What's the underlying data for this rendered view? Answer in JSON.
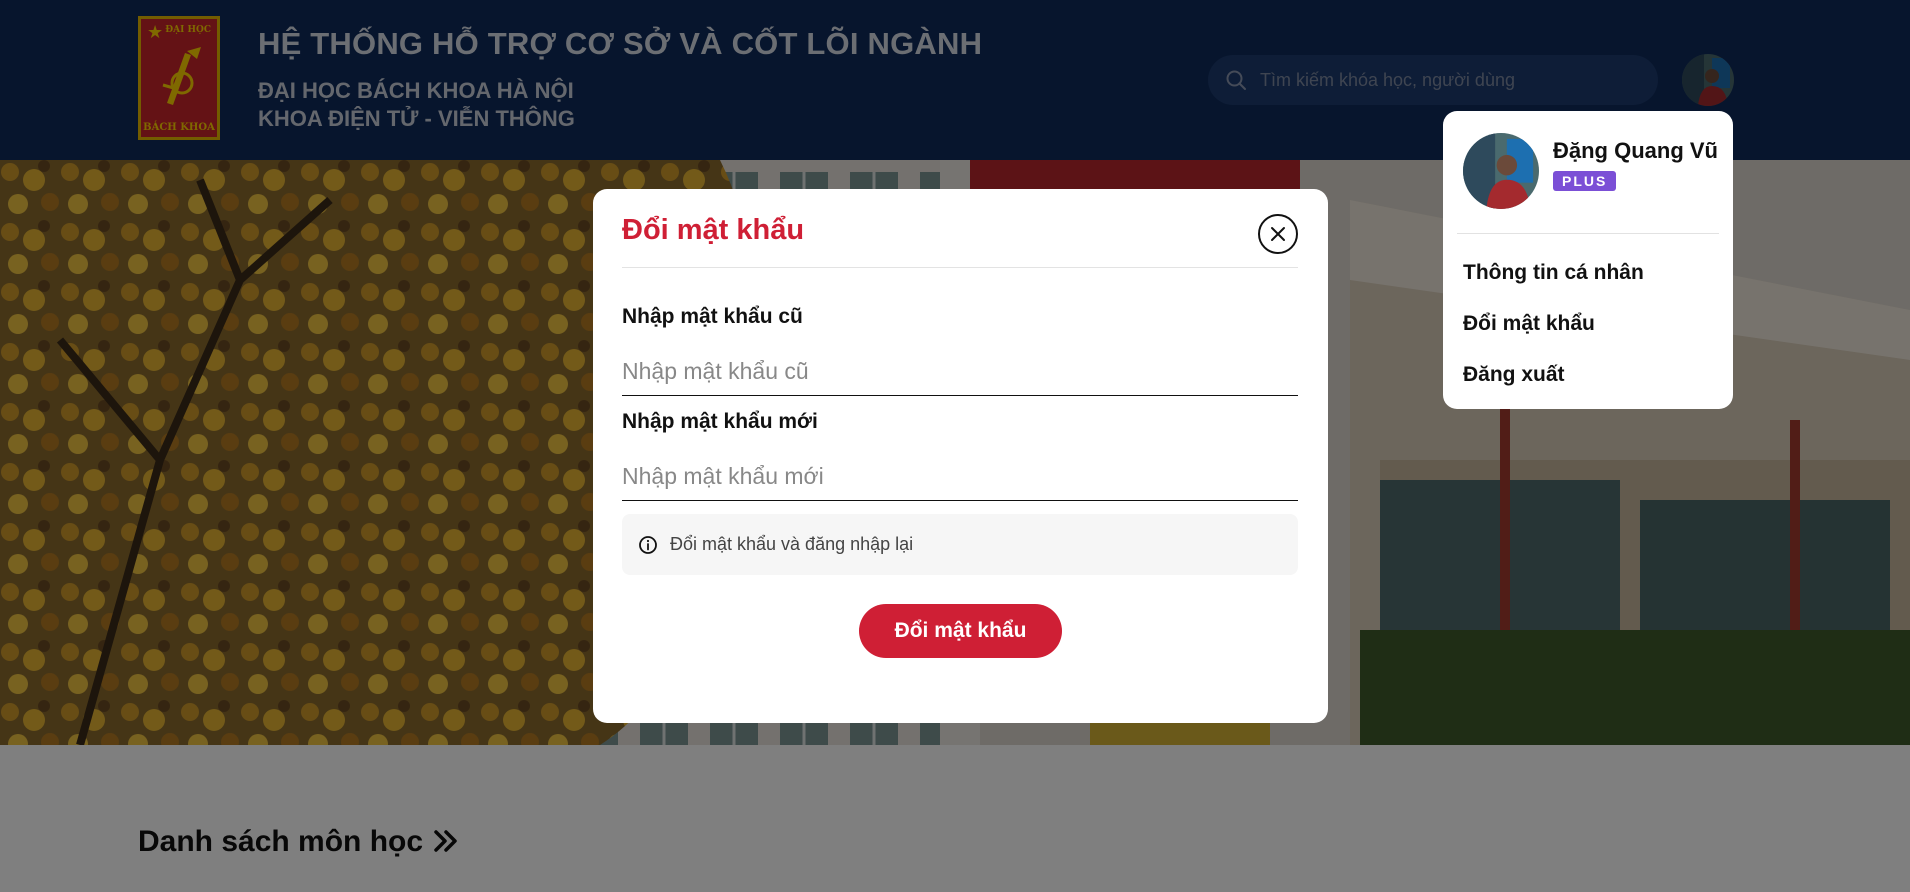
{
  "header": {
    "logo_text_top": "ĐẠI HỌC",
    "logo_text_bottom": "BÁCH KHOA",
    "title": "HỆ THỐNG HỖ TRỢ CƠ SỞ VÀ CỐT LÕI NGÀNH",
    "subtitle_line1": "ĐẠI HỌC BÁCH KHOA HÀ NỘI",
    "subtitle_line2": "KHOA ĐIỆN TỬ - VIỄN THÔNG",
    "search": {
      "placeholder": "Tìm kiếm khóa học, người dùng",
      "value": ""
    }
  },
  "content": {
    "section_title": "Danh sách môn học"
  },
  "user_menu": {
    "name": "Đặng Quang Vũ",
    "badge": "PLUS",
    "items": [
      {
        "label": "Thông tin cá nhân"
      },
      {
        "label": "Đổi mật khẩu"
      },
      {
        "label": "Đăng xuất"
      }
    ]
  },
  "modal": {
    "title": "Đổi mật khẩu",
    "old_password": {
      "label": "Nhập mật khẩu cũ",
      "placeholder": "Nhập mật khẩu cũ",
      "value": ""
    },
    "new_password": {
      "label": "Nhập mật khẩu mới",
      "placeholder": "Nhập mật khẩu mới",
      "value": ""
    },
    "note": "Đổi mật khẩu và đăng nhập lại",
    "submit_label": "Đổi mật khẩu"
  },
  "colors": {
    "header_bg": "#0f2b5b",
    "accent_red": "#cf1f35",
    "badge_purple": "#7b4fd6"
  },
  "icons": [
    "search-icon",
    "close-icon",
    "info-icon",
    "double-chevron-right-icon"
  ]
}
